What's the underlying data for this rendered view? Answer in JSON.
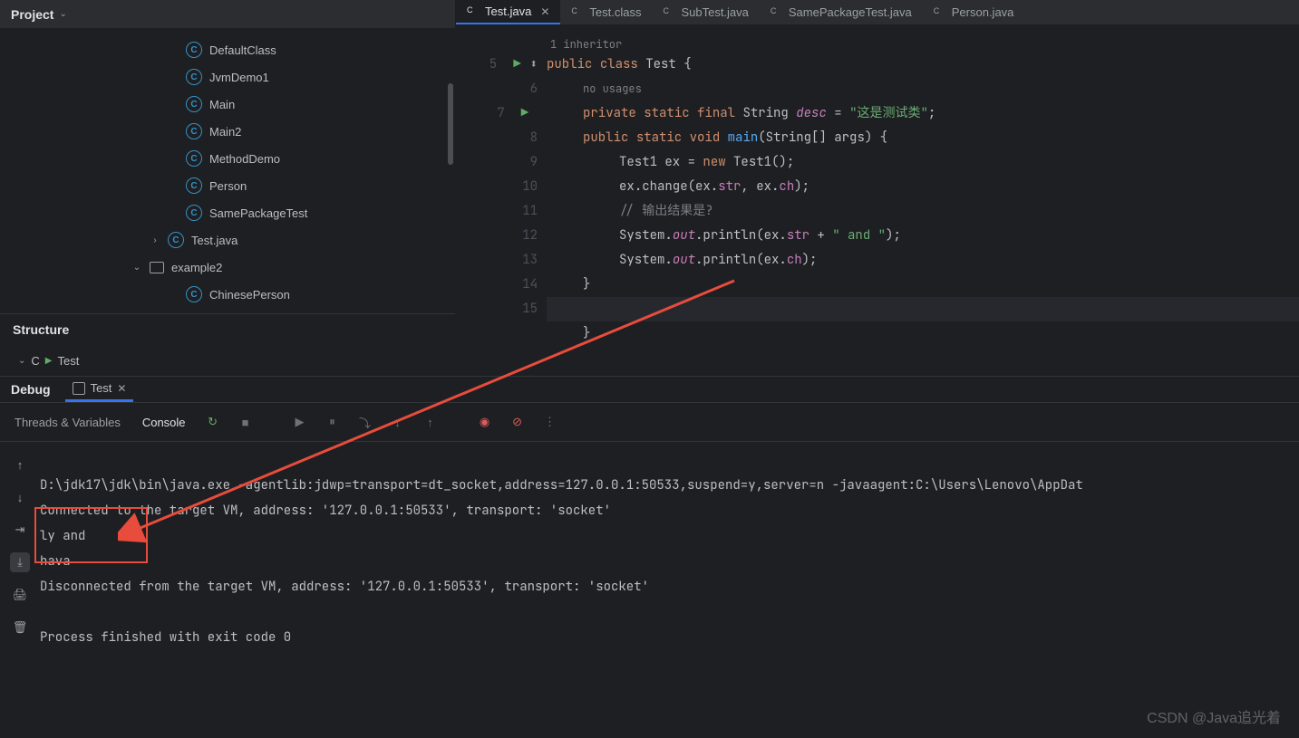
{
  "project_label": "Project",
  "tree": [
    {
      "indent": 185,
      "arrow": "",
      "icon": "class",
      "name": "DefaultClass"
    },
    {
      "indent": 185,
      "arrow": "",
      "icon": "class",
      "name": "JvmDemo1"
    },
    {
      "indent": 185,
      "arrow": "",
      "icon": "class",
      "name": "Main"
    },
    {
      "indent": 185,
      "arrow": "",
      "icon": "class",
      "name": "Main2"
    },
    {
      "indent": 185,
      "arrow": "",
      "icon": "class",
      "name": "MethodDemo"
    },
    {
      "indent": 185,
      "arrow": "",
      "icon": "class",
      "name": "Person"
    },
    {
      "indent": 185,
      "arrow": "",
      "icon": "class",
      "name": "SamePackageTest"
    },
    {
      "indent": 165,
      "arrow": "›",
      "icon": "class",
      "name": "Test.java"
    },
    {
      "indent": 145,
      "arrow": "⌄",
      "icon": "folder",
      "name": "example2"
    },
    {
      "indent": 185,
      "arrow": "",
      "icon": "class",
      "name": "ChinesePerson"
    }
  ],
  "structure_label": "Structure",
  "structure_item": "Test",
  "tabs": [
    {
      "name": "Test.java",
      "active": true
    },
    {
      "name": "Test.class",
      "active": false
    },
    {
      "name": "SubTest.java",
      "active": false
    },
    {
      "name": "SamePackageTest.java",
      "active": false
    },
    {
      "name": "Person.java",
      "active": false
    }
  ],
  "inlay_top": "1 inheritor",
  "inlay_usages": "no usages",
  "code": {
    "l5": {
      "num": "5",
      "run": true,
      "impl": true
    },
    "l6": {
      "num": "6"
    },
    "l7": {
      "num": "7",
      "run": true
    },
    "l8": {
      "num": "8"
    },
    "l9": {
      "num": "9"
    },
    "l10": {
      "num": "10"
    },
    "l11": {
      "num": "11"
    },
    "l12": {
      "num": "12"
    },
    "l13": {
      "num": "13"
    },
    "l14": {
      "num": "14"
    },
    "l15": {
      "num": "15"
    }
  },
  "code_tokens": {
    "public": "public",
    "class": "class",
    "Test": "Test",
    "lb": "{",
    "private": "private",
    "static": "static",
    "final": "final",
    "String": "String",
    "desc": "desc",
    "eq": " = ",
    "desc_str": "\"这是测试类\"",
    "semi": ";",
    "void": "void",
    "main": "main",
    "args": "(String[] args) {",
    "Test1": "Test1",
    "ex": "ex",
    "new": "new",
    "Test1c": "Test1();",
    "change": ".change(ex.",
    "str": "str",
    "comma": ", ex.",
    "ch": "ch",
    "close_p": ");",
    "comment": "// 输出结果是?",
    "System": "System.",
    "out": "out",
    "println": ".println(ex.",
    "plus_and": " + ",
    "and_str": "\" and \"",
    "rb": "}"
  },
  "debug_label": "Debug",
  "debug_tab": "Test",
  "tool_tabs": {
    "threads": "Threads & Variables",
    "console": "Console"
  },
  "console_lines": {
    "l1": "D:\\jdk17\\jdk\\bin\\java.exe -agentlib:jdwp=transport=dt_socket,address=127.0.0.1:50533,suspend=y,server=n -javaagent:C:\\Users\\Lenovo\\AppDat",
    "l2": "Connected to the target VM, address: '127.0.0.1:50533', transport: 'socket'",
    "l3": "ly and ",
    "l4": "hava",
    "l5": "Disconnected from the target VM, address: '127.0.0.1:50533', transport: 'socket'",
    "l6": "",
    "l7": "Process finished with exit code 0"
  },
  "watermark": "CSDN @Java追光着"
}
